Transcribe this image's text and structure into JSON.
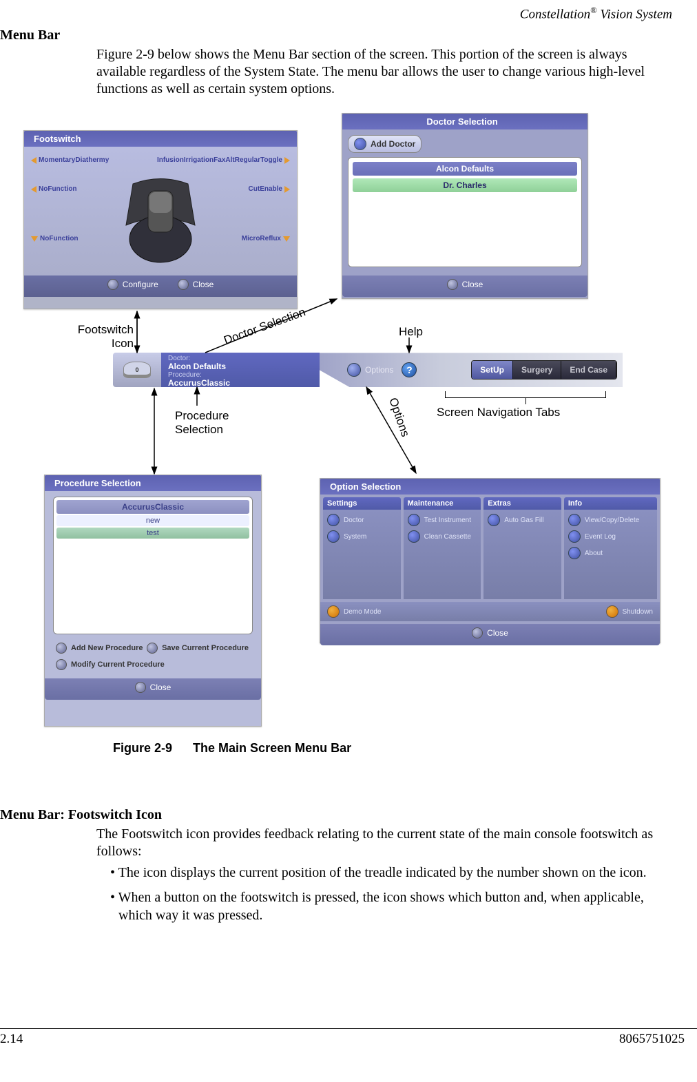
{
  "header": {
    "product": "Constellation",
    "suffix": " Vision System",
    "reg": "®"
  },
  "section1": {
    "title": "Menu Bar",
    "para": "Figure 2-9 below shows the Menu Bar section of the screen. This portion of the screen is always available regardless of the System State. The menu bar allows the user to change various high-level functions as well as certain system options."
  },
  "footswitch": {
    "title": "Footswitch",
    "labels": {
      "tl": "MomentaryDiathermy",
      "tr": "InfusionIrrigationFaxAltRegularToggle",
      "ml": "NoFunction",
      "mr": "CutEnable",
      "bl": "NoFunction",
      "br": "MicroReflux"
    },
    "configure": "Configure",
    "close": "Close"
  },
  "doctor": {
    "title": "Doctor Selection",
    "add": "Add Doctor",
    "defaults": "Alcon Defaults",
    "selected": "Dr. Charles",
    "close": "Close"
  },
  "menubar": {
    "doctor_label": "Doctor:",
    "doctor_value": "Alcon Defaults",
    "procedure_label": "Procedure:",
    "procedure_value": "AccurusClassic",
    "options": "Options",
    "help": "?",
    "tabs": {
      "setup": "SetUp",
      "surgery": "Surgery",
      "endcase": "End Case"
    }
  },
  "callouts": {
    "footswitch_icon": "Footswitch\nIcon",
    "doctor_selection": "Doctor Selection",
    "help": "Help",
    "procedure_selection": "Procedure\nSelection",
    "options": "Options",
    "nav_tabs": "Screen Navigation Tabs"
  },
  "procedure": {
    "title": "Procedure Selection",
    "header": "AccurusClassic",
    "rows": [
      "new",
      "test"
    ],
    "add": "Add New Procedure",
    "save": "Save Current Procedure",
    "modify": "Modify Current Procedure",
    "close": "Close"
  },
  "options": {
    "title": "Option Selection",
    "cols": {
      "settings": {
        "label": "Settings",
        "items": [
          "Doctor",
          "System"
        ]
      },
      "maintenance": {
        "label": "Maintenance",
        "items": [
          "Test Instrument",
          "Clean Cassette"
        ]
      },
      "extras": {
        "label": "Extras",
        "items": [
          "Auto Gas Fill"
        ]
      },
      "info": {
        "label": "Info",
        "items": [
          "View/Copy/Delete",
          "Event Log",
          "About"
        ]
      }
    },
    "demo": "Demo Mode",
    "shutdown": "Shutdown",
    "close": "Close"
  },
  "figcaption": {
    "num": "Figure 2-9",
    "title": "The Main Screen Menu Bar"
  },
  "section2": {
    "title": "Menu Bar: Footswitch Icon",
    "para": "The Footswitch icon provides feedback relating to the current state of the main console footswitch as follows:",
    "bullet1": "• The icon displays the current position of the treadle indicated by the number shown on the icon.",
    "bullet2": "• When a button on the footswitch is pressed, the icon shows which button and, when applicable, which way it was pressed."
  },
  "footer": {
    "left": "2.14",
    "right": "8065751025"
  }
}
